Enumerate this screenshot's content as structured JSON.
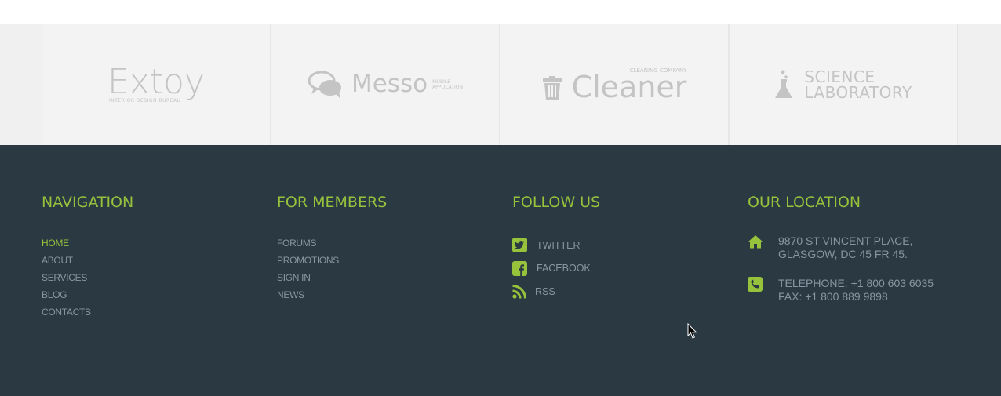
{
  "partners": [
    {
      "name": "Extoy",
      "tagline": "INTERIOR DESIGN BUREAU"
    },
    {
      "name": "Messo",
      "tagline_line1": "MOBILE",
      "tagline_line2": "APPLICATION"
    },
    {
      "name": "Cleaner",
      "tagline": "CLEANING COMPANY"
    },
    {
      "name_line1": "SCIENCE",
      "name_line2": "LABORATORY"
    }
  ],
  "footer": {
    "navigation": {
      "title": "NAVIGATION",
      "items": [
        {
          "label": "HOME",
          "active": true
        },
        {
          "label": "ABOUT"
        },
        {
          "label": "SERVICES"
        },
        {
          "label": "BLOG"
        },
        {
          "label": "CONTACTS"
        }
      ]
    },
    "members": {
      "title": "FOR MEMBERS",
      "items": [
        {
          "label": "FORUMS"
        },
        {
          "label": "PROMOTIONS"
        },
        {
          "label": "SIGN IN"
        },
        {
          "label": "NEWS"
        }
      ]
    },
    "follow": {
      "title": "FOLLOW US",
      "items": [
        {
          "label": "TWITTER",
          "icon": "twitter-icon"
        },
        {
          "label": "FACEBOOK",
          "icon": "facebook-icon"
        },
        {
          "label": "RSS",
          "icon": "rss-icon"
        }
      ]
    },
    "location": {
      "title": "OUR LOCATION",
      "address_line1": "9870 ST VINCENT PLACE,",
      "address_line2": "GLASGOW, DC 45 FR 45.",
      "telephone": "TELEPHONE: +1 800 603 6035",
      "fax": "FAX: +1 800 889 9898"
    }
  },
  "colors": {
    "accent": "#97c23c",
    "footer_bg": "#2b3943",
    "footer_text": "#8796a0",
    "partners_bg": "#f3f3f3",
    "logo_gray": "#c4c4c4"
  }
}
